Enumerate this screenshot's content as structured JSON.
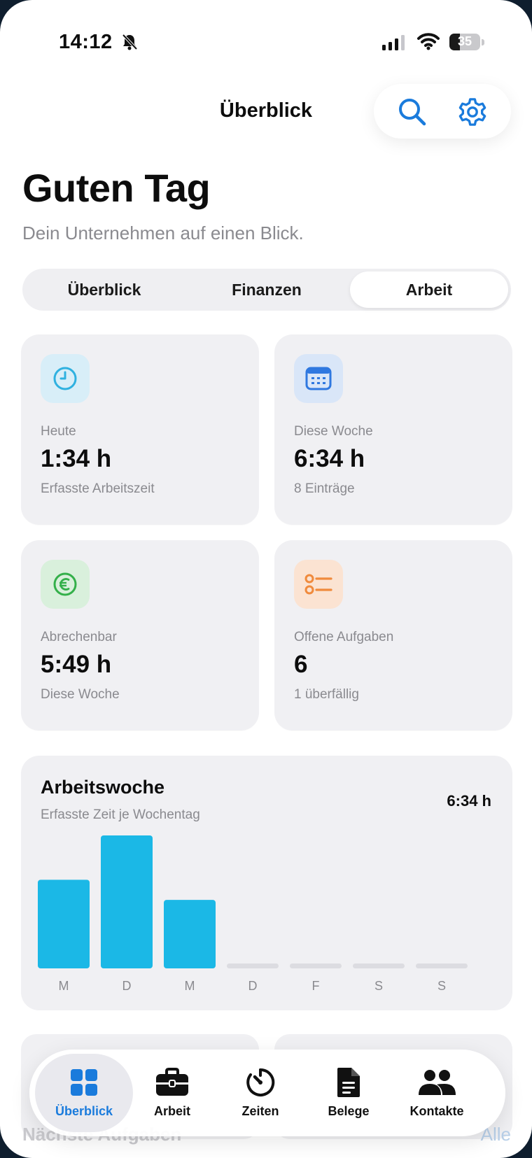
{
  "status_bar": {
    "time": "14:12",
    "battery": "35",
    "icons": [
      "bell-slash-icon",
      "signal-icon",
      "wifi-icon",
      "battery-icon"
    ]
  },
  "header": {
    "title": "Überblick",
    "search_icon": "search-icon",
    "settings_icon": "gear-icon"
  },
  "greeting": {
    "title": "Guten Tag",
    "subtitle": "Dein Unternehmen auf einen Blick."
  },
  "segments": {
    "items": [
      "Überblick",
      "Finanzen",
      "Arbeit"
    ],
    "selected": "Arbeit"
  },
  "cards": [
    {
      "icon": "clock-icon",
      "label": "Heute",
      "value": "1:34 h",
      "sub": "Erfasste Arbeitszeit",
      "color": "#2fb1e0"
    },
    {
      "icon": "calendar-icon",
      "label": "Diese Woche",
      "value": "6:34 h",
      "sub": "8 Einträge",
      "color": "#2f78e0"
    },
    {
      "icon": "euro-icon",
      "label": "Abrechenbar",
      "value": "5:49 h",
      "sub": "Diese Woche",
      "color": "#34b04a"
    },
    {
      "icon": "list-icon",
      "label": "Offene Aufgaben",
      "value": "6",
      "sub": "1 überfällig",
      "color": "#f08a3c"
    }
  ],
  "chart_data": {
    "type": "bar",
    "title": "Arbeitswoche",
    "subtitle": "Erfasste Zeit je Wochentag",
    "total": "6:34 h",
    "categories": [
      "M",
      "D",
      "M",
      "D",
      "F",
      "S",
      "S"
    ],
    "values": [
      2.2,
      3.3,
      1.7,
      0,
      0,
      0,
      0
    ],
    "unit": "h",
    "bar_color": "#1bb8e6",
    "empty_color": "#dcdce1",
    "grid": false
  },
  "next_section": {
    "title": "Nächste Aufgaben",
    "link": "Alle"
  },
  "tabbar": {
    "selected": "Überblick",
    "items": [
      {
        "label": "Überblick",
        "icon": "grid-icon"
      },
      {
        "label": "Arbeit",
        "icon": "briefcase-icon"
      },
      {
        "label": "Zeiten",
        "icon": "timer-icon"
      },
      {
        "label": "Belege",
        "icon": "document-icon"
      },
      {
        "label": "Kontakte",
        "icon": "people-icon"
      }
    ]
  },
  "colors": {
    "accent": "#1a7bdc",
    "card_bg": "#f0f0f3"
  }
}
